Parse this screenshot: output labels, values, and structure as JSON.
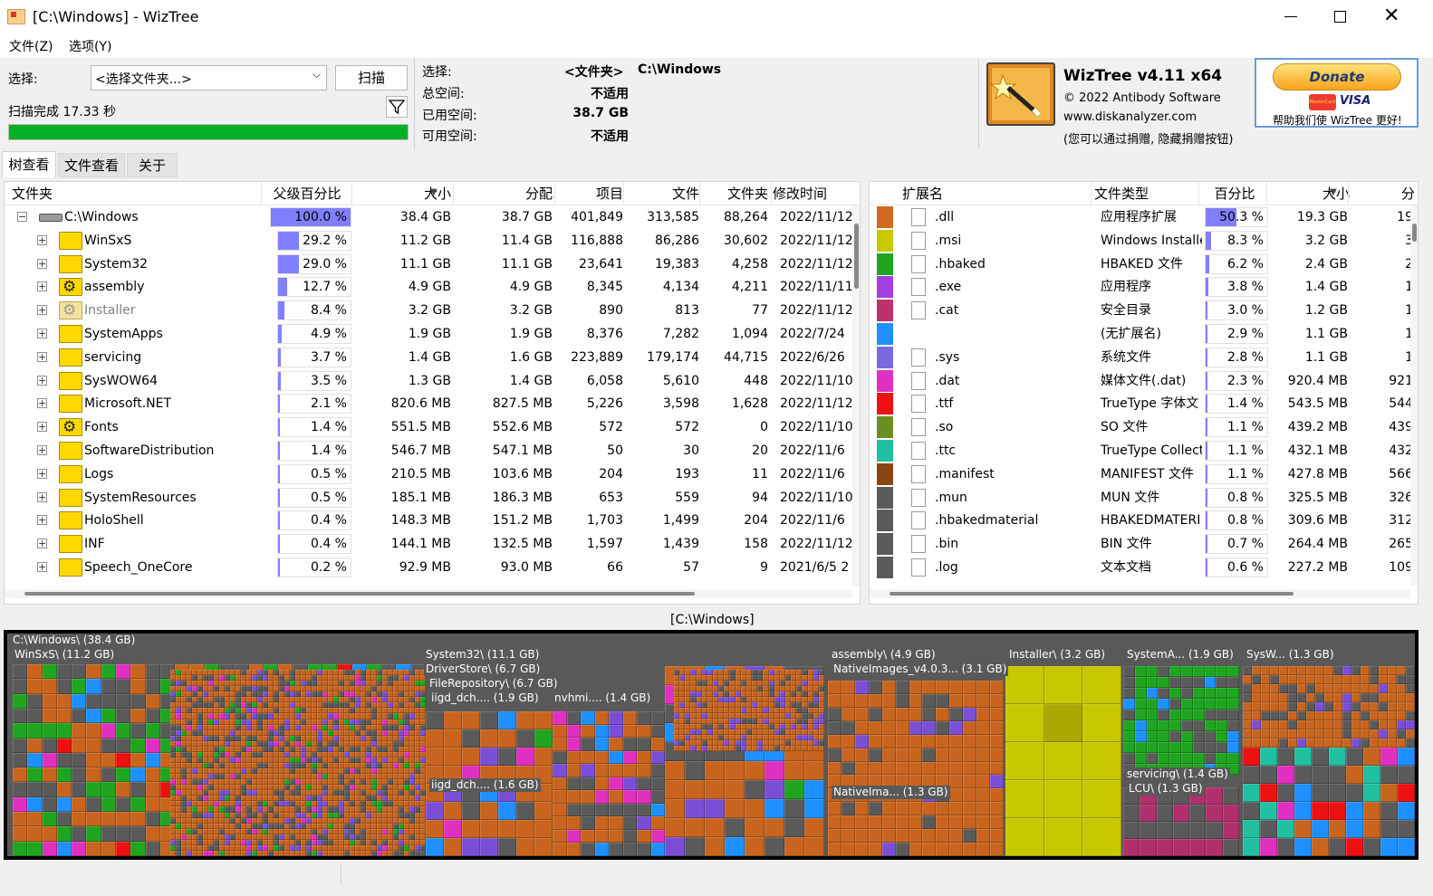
{
  "window": {
    "title": "[C:\\Windows]  - WizTree"
  },
  "menu": [
    "文件(Z)",
    "选项(Y)"
  ],
  "toolbar": {
    "select_label": "选择:",
    "select_value": "<选择文件夹...>",
    "scan_button": "扫描",
    "status": "扫描完成 17.33 秒",
    "progress": 1.0
  },
  "info": {
    "rows": [
      {
        "label": "选择:",
        "value": "<文件夹>",
        "extra": "C:\\Windows"
      },
      {
        "label": "总空间:",
        "value": "不适用"
      },
      {
        "label": "已用空间:",
        "value": "38.7 GB"
      },
      {
        "label": "可用空间:",
        "value": "不适用"
      }
    ]
  },
  "about": {
    "product": "WizTree v4.11 x64",
    "copyright": "© 2022 Antibody Software",
    "website": "www.diskanalyzer.com",
    "note": "(您可以通过捐赠, 隐藏捐赠按钮)",
    "donate_label": "Donate",
    "cards": [
      "MasterCard",
      "VISA"
    ],
    "donate_caption": "帮助我们使 WizTree 更好!"
  },
  "tabs": [
    "树查看",
    "文件查看",
    "关于"
  ],
  "tree": {
    "columns": [
      "文件夹",
      "父级百分比",
      "大小",
      "分配",
      "项目",
      "文件",
      "文件夹",
      "修改时间"
    ],
    "root": {
      "name": "C:\\Windows",
      "pct": "100.0 %",
      "pct_val": 100.0,
      "size": "38.4 GB",
      "alloc": "38.7 GB",
      "items": "401,849",
      "files": "313,585",
      "folders": "88,264",
      "modified": "2022/11/12"
    },
    "rows": [
      {
        "name": "WinSxS",
        "icon": "folder",
        "pct": "29.2 %",
        "pct_val": 29.2,
        "size": "11.2 GB",
        "alloc": "11.4 GB",
        "items": "116,888",
        "files": "86,286",
        "folders": "30,602",
        "modified": "2022/11/12"
      },
      {
        "name": "System32",
        "icon": "folder",
        "pct": "29.0 %",
        "pct_val": 29.0,
        "size": "11.1 GB",
        "alloc": "11.1 GB",
        "items": "23,641",
        "files": "19,383",
        "folders": "4,258",
        "modified": "2022/11/12"
      },
      {
        "name": "assembly",
        "icon": "gear-folder",
        "pct": "12.7 %",
        "pct_val": 12.7,
        "size": "4.9 GB",
        "alloc": "4.9 GB",
        "items": "8,345",
        "files": "4,134",
        "folders": "4,211",
        "modified": "2022/11/11"
      },
      {
        "name": "Installer",
        "icon": "gear-folder-gray",
        "pct": "8.4 %",
        "pct_val": 8.4,
        "size": "3.2 GB",
        "alloc": "3.2 GB",
        "items": "890",
        "files": "813",
        "folders": "77",
        "modified": "2022/11/12"
      },
      {
        "name": "SystemApps",
        "icon": "folder",
        "pct": "4.9 %",
        "pct_val": 4.9,
        "size": "1.9 GB",
        "alloc": "1.9 GB",
        "items": "8,376",
        "files": "7,282",
        "folders": "1,094",
        "modified": "2022/7/24"
      },
      {
        "name": "servicing",
        "icon": "folder",
        "pct": "3.7 %",
        "pct_val": 3.7,
        "size": "1.4 GB",
        "alloc": "1.6 GB",
        "items": "223,889",
        "files": "179,174",
        "folders": "44,715",
        "modified": "2022/6/26"
      },
      {
        "name": "SysWOW64",
        "icon": "folder",
        "pct": "3.5 %",
        "pct_val": 3.5,
        "size": "1.3 GB",
        "alloc": "1.4 GB",
        "items": "6,058",
        "files": "5,610",
        "folders": "448",
        "modified": "2022/11/10"
      },
      {
        "name": "Microsoft.NET",
        "icon": "folder",
        "pct": "2.1 %",
        "pct_val": 2.1,
        "size": "820.6 MB",
        "alloc": "827.5 MB",
        "items": "5,226",
        "files": "3,598",
        "folders": "1,628",
        "modified": "2022/11/12"
      },
      {
        "name": "Fonts",
        "icon": "gear-folder",
        "pct": "1.4 %",
        "pct_val": 1.4,
        "size": "551.5 MB",
        "alloc": "552.6 MB",
        "items": "572",
        "files": "572",
        "folders": "0",
        "modified": "2022/11/10"
      },
      {
        "name": "SoftwareDistribution",
        "icon": "folder",
        "pct": "1.4 %",
        "pct_val": 1.4,
        "size": "546.7 MB",
        "alloc": "547.1 MB",
        "items": "50",
        "files": "30",
        "folders": "20",
        "modified": "2022/11/6"
      },
      {
        "name": "Logs",
        "icon": "folder",
        "pct": "0.5 %",
        "pct_val": 0.5,
        "size": "210.5 MB",
        "alloc": "103.6 MB",
        "items": "204",
        "files": "193",
        "folders": "11",
        "modified": "2022/11/6"
      },
      {
        "name": "SystemResources",
        "icon": "folder",
        "pct": "0.5 %",
        "pct_val": 0.5,
        "size": "185.1 MB",
        "alloc": "186.3 MB",
        "items": "653",
        "files": "559",
        "folders": "94",
        "modified": "2022/11/10"
      },
      {
        "name": "HoloShell",
        "icon": "folder",
        "pct": "0.4 %",
        "pct_val": 0.4,
        "size": "148.3 MB",
        "alloc": "151.2 MB",
        "items": "1,703",
        "files": "1,499",
        "folders": "204",
        "modified": "2022/11/6"
      },
      {
        "name": "INF",
        "icon": "folder",
        "pct": "0.4 %",
        "pct_val": 0.4,
        "size": "144.1 MB",
        "alloc": "132.5 MB",
        "items": "1,597",
        "files": "1,439",
        "folders": "158",
        "modified": "2022/11/12"
      },
      {
        "name": "Speech_OneCore",
        "icon": "folder",
        "pct": "0.2 %",
        "pct_val": 0.2,
        "size": "92.9 MB",
        "alloc": "93.0 MB",
        "items": "66",
        "files": "57",
        "folders": "9",
        "modified": "2021/6/5 2"
      }
    ]
  },
  "extensions": {
    "columns": [
      "扩展名",
      "文件类型",
      "百分比",
      "大小",
      "分"
    ],
    "rows": [
      {
        "color": "#d2691e",
        "ext": ".dll",
        "type": "应用程序扩展",
        "pct": "50.3 %",
        "pct_val": 50.3,
        "size": "19.3 GB",
        "alloc": "19"
      },
      {
        "color": "#c8c800",
        "ext": ".msi",
        "type": "Windows Installe",
        "pct": "8.3 %",
        "pct_val": 8.3,
        "size": "3.2 GB",
        "alloc": "3"
      },
      {
        "color": "#1fa51f",
        "ext": ".hbaked",
        "type": "HBAKED 文件",
        "pct": "6.2 %",
        "pct_val": 6.2,
        "size": "2.4 GB",
        "alloc": "2"
      },
      {
        "color": "#a040e0",
        "ext": ".exe",
        "type": "应用程序",
        "pct": "3.8 %",
        "pct_val": 3.8,
        "size": "1.4 GB",
        "alloc": "1"
      },
      {
        "color": "#c0306c",
        "ext": ".cat",
        "type": "安全目录",
        "pct": "3.0 %",
        "pct_val": 3.0,
        "size": "1.2 GB",
        "alloc": "1"
      },
      {
        "color": "#1e90ff",
        "ext": "",
        "type": "(无扩展名)",
        "pct": "2.9 %",
        "pct_val": 2.9,
        "size": "1.1 GB",
        "alloc": "1"
      },
      {
        "color": "#7a6adf",
        "ext": ".sys",
        "type": "系统文件",
        "pct": "2.8 %",
        "pct_val": 2.8,
        "size": "1.1 GB",
        "alloc": "1"
      },
      {
        "color": "#e030c0",
        "ext": ".dat",
        "type": "媒体文件(.dat)",
        "pct": "2.3 %",
        "pct_val": 2.3,
        "size": "920.4 MB",
        "alloc": "921"
      },
      {
        "color": "#ee1111",
        "ext": ".ttf",
        "type": "TrueType 字体文",
        "pct": "1.4 %",
        "pct_val": 1.4,
        "size": "543.5 MB",
        "alloc": "544"
      },
      {
        "color": "#6b8e23",
        "ext": ".so",
        "type": "SO 文件",
        "pct": "1.1 %",
        "pct_val": 1.1,
        "size": "439.2 MB",
        "alloc": "439"
      },
      {
        "color": "#20c0a0",
        "ext": ".ttc",
        "type": "TrueType Collect",
        "pct": "1.1 %",
        "pct_val": 1.1,
        "size": "432.1 MB",
        "alloc": "432"
      },
      {
        "color": "#8b4513",
        "ext": ".manifest",
        "type": "MANIFEST 文件",
        "pct": "1.1 %",
        "pct_val": 1.1,
        "size": "427.8 MB",
        "alloc": "566"
      },
      {
        "color": "#5a5a5a",
        "ext": ".mun",
        "type": "MUN 文件",
        "pct": "0.8 %",
        "pct_val": 0.8,
        "size": "325.5 MB",
        "alloc": "326"
      },
      {
        "color": "#5a5a5a",
        "ext": ".hbakedmaterial",
        "type": "HBAKEDMATERI",
        "pct": "0.8 %",
        "pct_val": 0.8,
        "size": "309.6 MB",
        "alloc": "312"
      },
      {
        "color": "#5a5a5a",
        "ext": ".bin",
        "type": "BIN 文件",
        "pct": "0.7 %",
        "pct_val": 0.7,
        "size": "264.4 MB",
        "alloc": "265"
      },
      {
        "color": "#5a5a5a",
        "ext": ".log",
        "type": "文本文档",
        "pct": "0.6 %",
        "pct_val": 0.6,
        "size": "227.2 MB",
        "alloc": "109"
      }
    ]
  },
  "treemap": {
    "caption": "[C:\\Windows]",
    "labels": [
      "C:\\Windows\\ (38.4 GB)",
      "WinSxS\\ (11.2 GB)",
      "System32\\ (11.1 GB)",
      "DriverStore\\ (6.7 GB)",
      "FileRepository\\ (6.7 GB)",
      "iigd_dch.... (1.9 GB)",
      "nvhmi.... (1.4 GB)",
      "iigd_dch.... (1.6 GB)",
      "assembly\\ (4.9 GB)",
      "NativeImages_v4.0.3... (3.1 GB)",
      "NativeIma... (1.3 GB)",
      "Installer\\ (3.2 GB)",
      "SystemA... (1.9 GB)",
      "SysW... (1.3 GB)",
      "servicing\\ (1.4 GB)",
      "LCU\\ (1.3 GB)"
    ]
  }
}
